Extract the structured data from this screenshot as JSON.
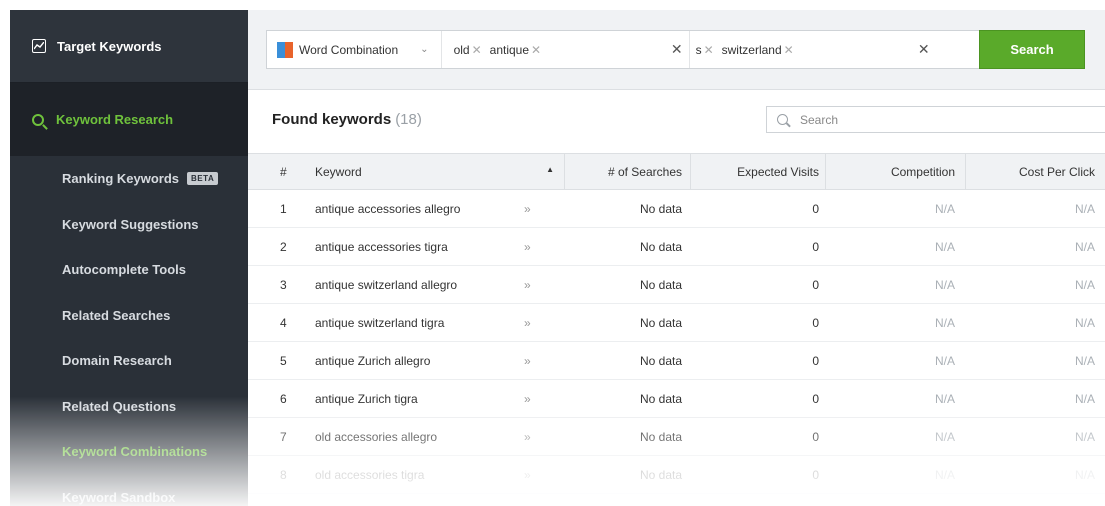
{
  "sidebar": {
    "top_item": {
      "label": "Target Keywords",
      "icon": "chart-icon"
    },
    "active_item": {
      "label": "Keyword Research",
      "icon": "search-icon",
      "accent": "#6fc23c"
    },
    "sub_items": [
      {
        "label": "Ranking Keywords",
        "badge": "BETA"
      },
      {
        "label": "Keyword Suggestions"
      },
      {
        "label": "Autocomplete Tools"
      },
      {
        "label": "Related Searches"
      },
      {
        "label": "Domain Research"
      },
      {
        "label": "Related Questions"
      },
      {
        "label": "Keyword Combinations",
        "current": true
      },
      {
        "label": "Keyword Sandbox"
      }
    ]
  },
  "search": {
    "mode": "Word Combination",
    "group1": [
      "old",
      "antique"
    ],
    "group2": [
      "s",
      "switzerland"
    ],
    "button": "Search",
    "button_color": "#5aaa2a"
  },
  "results": {
    "title": "Found keywords",
    "count": "(18)",
    "search_placeholder": "Search"
  },
  "table": {
    "columns": [
      "#",
      "Keyword",
      "# of Searches",
      "Expected Visits",
      "Competition",
      "Cost Per Click"
    ],
    "rows": [
      {
        "n": "1",
        "keyword": "antique accessories allegro",
        "searches": "No data",
        "visits": "0",
        "competition": "N/A",
        "cpc": "N/A"
      },
      {
        "n": "2",
        "keyword": "antique accessories tigra",
        "searches": "No data",
        "visits": "0",
        "competition": "N/A",
        "cpc": "N/A"
      },
      {
        "n": "3",
        "keyword": "antique switzerland allegro",
        "searches": "No data",
        "visits": "0",
        "competition": "N/A",
        "cpc": "N/A"
      },
      {
        "n": "4",
        "keyword": "antique switzerland tigra",
        "searches": "No data",
        "visits": "0",
        "competition": "N/A",
        "cpc": "N/A"
      },
      {
        "n": "5",
        "keyword": "antique Zurich allegro",
        "searches": "No data",
        "visits": "0",
        "competition": "N/A",
        "cpc": "N/A"
      },
      {
        "n": "6",
        "keyword": "antique Zurich tigra",
        "searches": "No data",
        "visits": "0",
        "competition": "N/A",
        "cpc": "N/A"
      },
      {
        "n": "7",
        "keyword": "old accessories allegro",
        "searches": "No data",
        "visits": "0",
        "competition": "N/A",
        "cpc": "N/A"
      },
      {
        "n": "8",
        "keyword": "old accessories tigra",
        "searches": "No data",
        "visits": "0",
        "competition": "N/A",
        "cpc": "N/A"
      }
    ]
  }
}
